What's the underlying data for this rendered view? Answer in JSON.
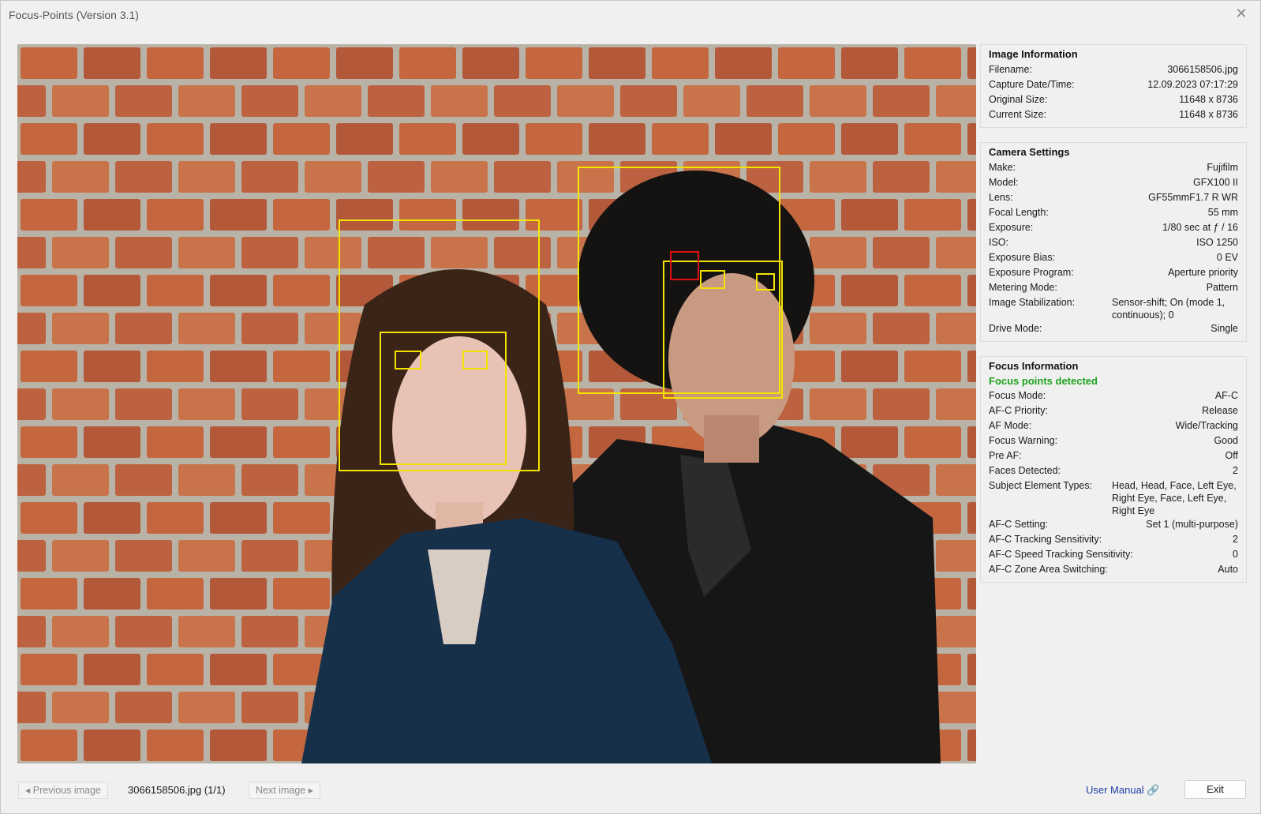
{
  "window": {
    "title": "Focus-Points (Version 3.1)",
    "close_glyph": "✕"
  },
  "image_information": {
    "heading": "Image Information",
    "rows": [
      {
        "k": "Filename:",
        "v": "3066158506.jpg"
      },
      {
        "k": "Capture Date/Time:",
        "v": "12.09.2023 07:17:29"
      },
      {
        "k": "Original Size:",
        "v": "11648 x 8736"
      },
      {
        "k": "Current Size:",
        "v": "11648 x 8736"
      }
    ]
  },
  "camera_settings": {
    "heading": "Camera Settings",
    "rows": [
      {
        "k": "Make:",
        "v": "Fujifilm"
      },
      {
        "k": "Model:",
        "v": "GFX100 II"
      },
      {
        "k": "Lens:",
        "v": "GF55mmF1.7 R WR"
      },
      {
        "k": "Focal Length:",
        "v": "55 mm"
      },
      {
        "k": "Exposure:",
        "v": "1/80 sec at ƒ / 16"
      },
      {
        "k": "ISO:",
        "v": "ISO 1250"
      },
      {
        "k": "Exposure Bias:",
        "v": "0 EV"
      },
      {
        "k": "Exposure Program:",
        "v": "Aperture priority"
      },
      {
        "k": "Metering Mode:",
        "v": "Pattern"
      },
      {
        "k": "Image Stabilization:",
        "v": "Sensor-shift; On (mode 1, continuous); 0"
      },
      {
        "k": "Drive Mode:",
        "v": "Single"
      }
    ]
  },
  "focus_information": {
    "heading": "Focus Information",
    "status": "Focus points detected",
    "rows": [
      {
        "k": "Focus Mode:",
        "v": "AF-C"
      },
      {
        "k": "AF-C Priority:",
        "v": "Release"
      },
      {
        "k": "AF Mode:",
        "v": "Wide/Tracking"
      },
      {
        "k": "Focus Warning:",
        "v": "Good"
      },
      {
        "k": "Pre AF:",
        "v": "Off"
      },
      {
        "k": "Faces Detected:",
        "v": "2"
      },
      {
        "k": "Subject Element Types:",
        "v": "Head, Head, Face, Left Eye, Right Eye, Face, Left Eye, Right Eye"
      },
      {
        "k": "AF-C Setting:",
        "v": "Set 1 (multi-purpose)"
      },
      {
        "k": "AF-C Tracking Sensitivity:",
        "v": "2"
      },
      {
        "k": "AF-C Speed Tracking Sensitivity:",
        "v": "0"
      },
      {
        "k": "AF-C Zone Area Switching:",
        "v": "Auto"
      }
    ]
  },
  "bottom": {
    "prev_label": "◂ Previous image",
    "file_label": "3066158506.jpg (1/1)",
    "next_label": "Next image ▸",
    "manual_label": "User Manual 🔗",
    "exit_label": "Exit"
  },
  "colors": {
    "focus_box": "#f5e400",
    "focus_point": "#e01010",
    "status_green": "#1da21d",
    "link": "#1f3fa8"
  }
}
